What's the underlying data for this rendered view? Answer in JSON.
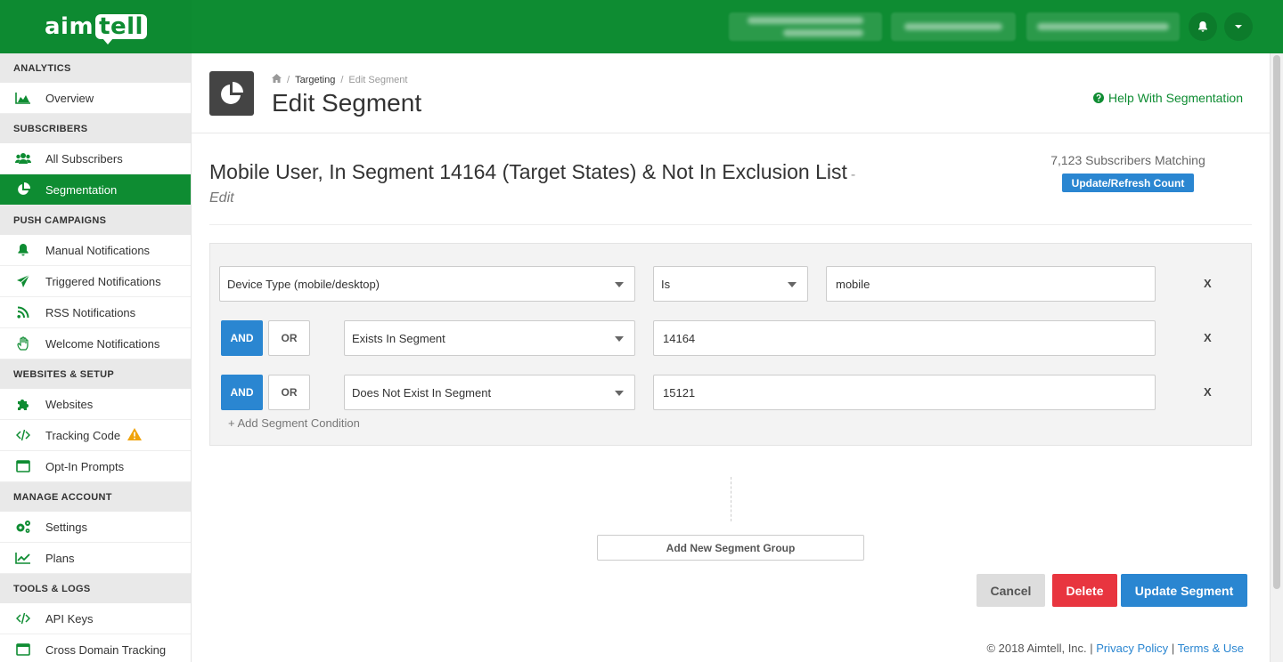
{
  "brand": {
    "logo_left": "aim",
    "logo_right": "tell"
  },
  "sidebar": {
    "sections": [
      {
        "label": "ANALYTICS",
        "items": [
          {
            "label": "Overview",
            "icon": "area-chart-icon"
          }
        ]
      },
      {
        "label": "SUBSCRIBERS",
        "items": [
          {
            "label": "All Subscribers",
            "icon": "users-icon"
          },
          {
            "label": "Segmentation",
            "icon": "pie-chart-icon",
            "active": true
          }
        ]
      },
      {
        "label": "PUSH CAMPAIGNS",
        "items": [
          {
            "label": "Manual Notifications",
            "icon": "bell-icon"
          },
          {
            "label": "Triggered Notifications",
            "icon": "paper-plane-icon"
          },
          {
            "label": "RSS Notifications",
            "icon": "rss-icon"
          },
          {
            "label": "Welcome Notifications",
            "icon": "hand-wave-icon"
          }
        ]
      },
      {
        "label": "WEBSITES & SETUP",
        "items": [
          {
            "label": "Websites",
            "icon": "puzzle-icon"
          },
          {
            "label": "Tracking Code",
            "icon": "code-icon",
            "warning": true
          },
          {
            "label": "Opt-In Prompts",
            "icon": "window-icon"
          }
        ]
      },
      {
        "label": "MANAGE ACCOUNT",
        "items": [
          {
            "label": "Settings",
            "icon": "cogs-icon"
          },
          {
            "label": "Plans",
            "icon": "line-chart-icon"
          }
        ]
      },
      {
        "label": "TOOLS & LOGS",
        "items": [
          {
            "label": "API Keys",
            "icon": "code-icon"
          },
          {
            "label": "Cross Domain Tracking",
            "icon": "window-icon"
          }
        ]
      }
    ]
  },
  "header": {
    "breadcrumb": {
      "parent": "Targeting",
      "separator": "/",
      "current": "Edit Segment"
    },
    "title": "Edit Segment",
    "help_link": "Help With Segmentation"
  },
  "segment": {
    "name": "Mobile User, In Segment 14164 (Target States) & Not In Exclusion List",
    "dash": "-",
    "edit_label": "Edit",
    "matching": "7,123 Subscribers Matching",
    "refresh_label": "Update/Refresh Count"
  },
  "conditions": [
    {
      "field": "Device Type (mobile/desktop)",
      "operator": "Is",
      "value": "mobile",
      "remove": "X"
    },
    {
      "join": "AND",
      "alt_join": "OR",
      "field": "Exists In Segment",
      "value": "14164",
      "remove": "X"
    },
    {
      "join": "AND",
      "alt_join": "OR",
      "field": "Does Not Exist In Segment",
      "value": "15121",
      "remove": "X"
    }
  ],
  "add_condition_label": "+ Add Segment Condition",
  "add_group_label": "Add New Segment Group",
  "actions": {
    "cancel": "Cancel",
    "delete": "Delete",
    "update": "Update Segment"
  },
  "footer": {
    "copyright": "© 2018 Aimtell, Inc. |",
    "privacy": "Privacy Policy",
    "sep": "|",
    "terms": "Terms & Use"
  },
  "colors": {
    "brand_green": "#0e8c32",
    "primary_blue": "#2a86d1",
    "danger_red": "#e8353f"
  }
}
